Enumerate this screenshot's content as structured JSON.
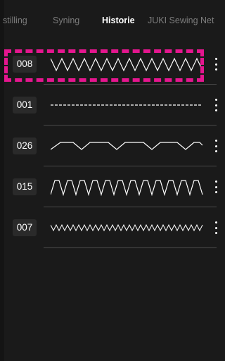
{
  "tabs": [
    {
      "label": "stilling"
    },
    {
      "label": "Syning"
    },
    {
      "label": "Historie"
    },
    {
      "label": "JUKI Sewing Net"
    }
  ],
  "active_tab": "Historie",
  "history": [
    {
      "code": "008",
      "pattern": "zigzag"
    },
    {
      "code": "001",
      "pattern": "straight-dashed"
    },
    {
      "code": "026",
      "pattern": "blind-hem"
    },
    {
      "code": "015",
      "pattern": "overlock"
    },
    {
      "code": "007",
      "pattern": "fine-zigzag"
    }
  ],
  "highlight_color": "#e5168f"
}
